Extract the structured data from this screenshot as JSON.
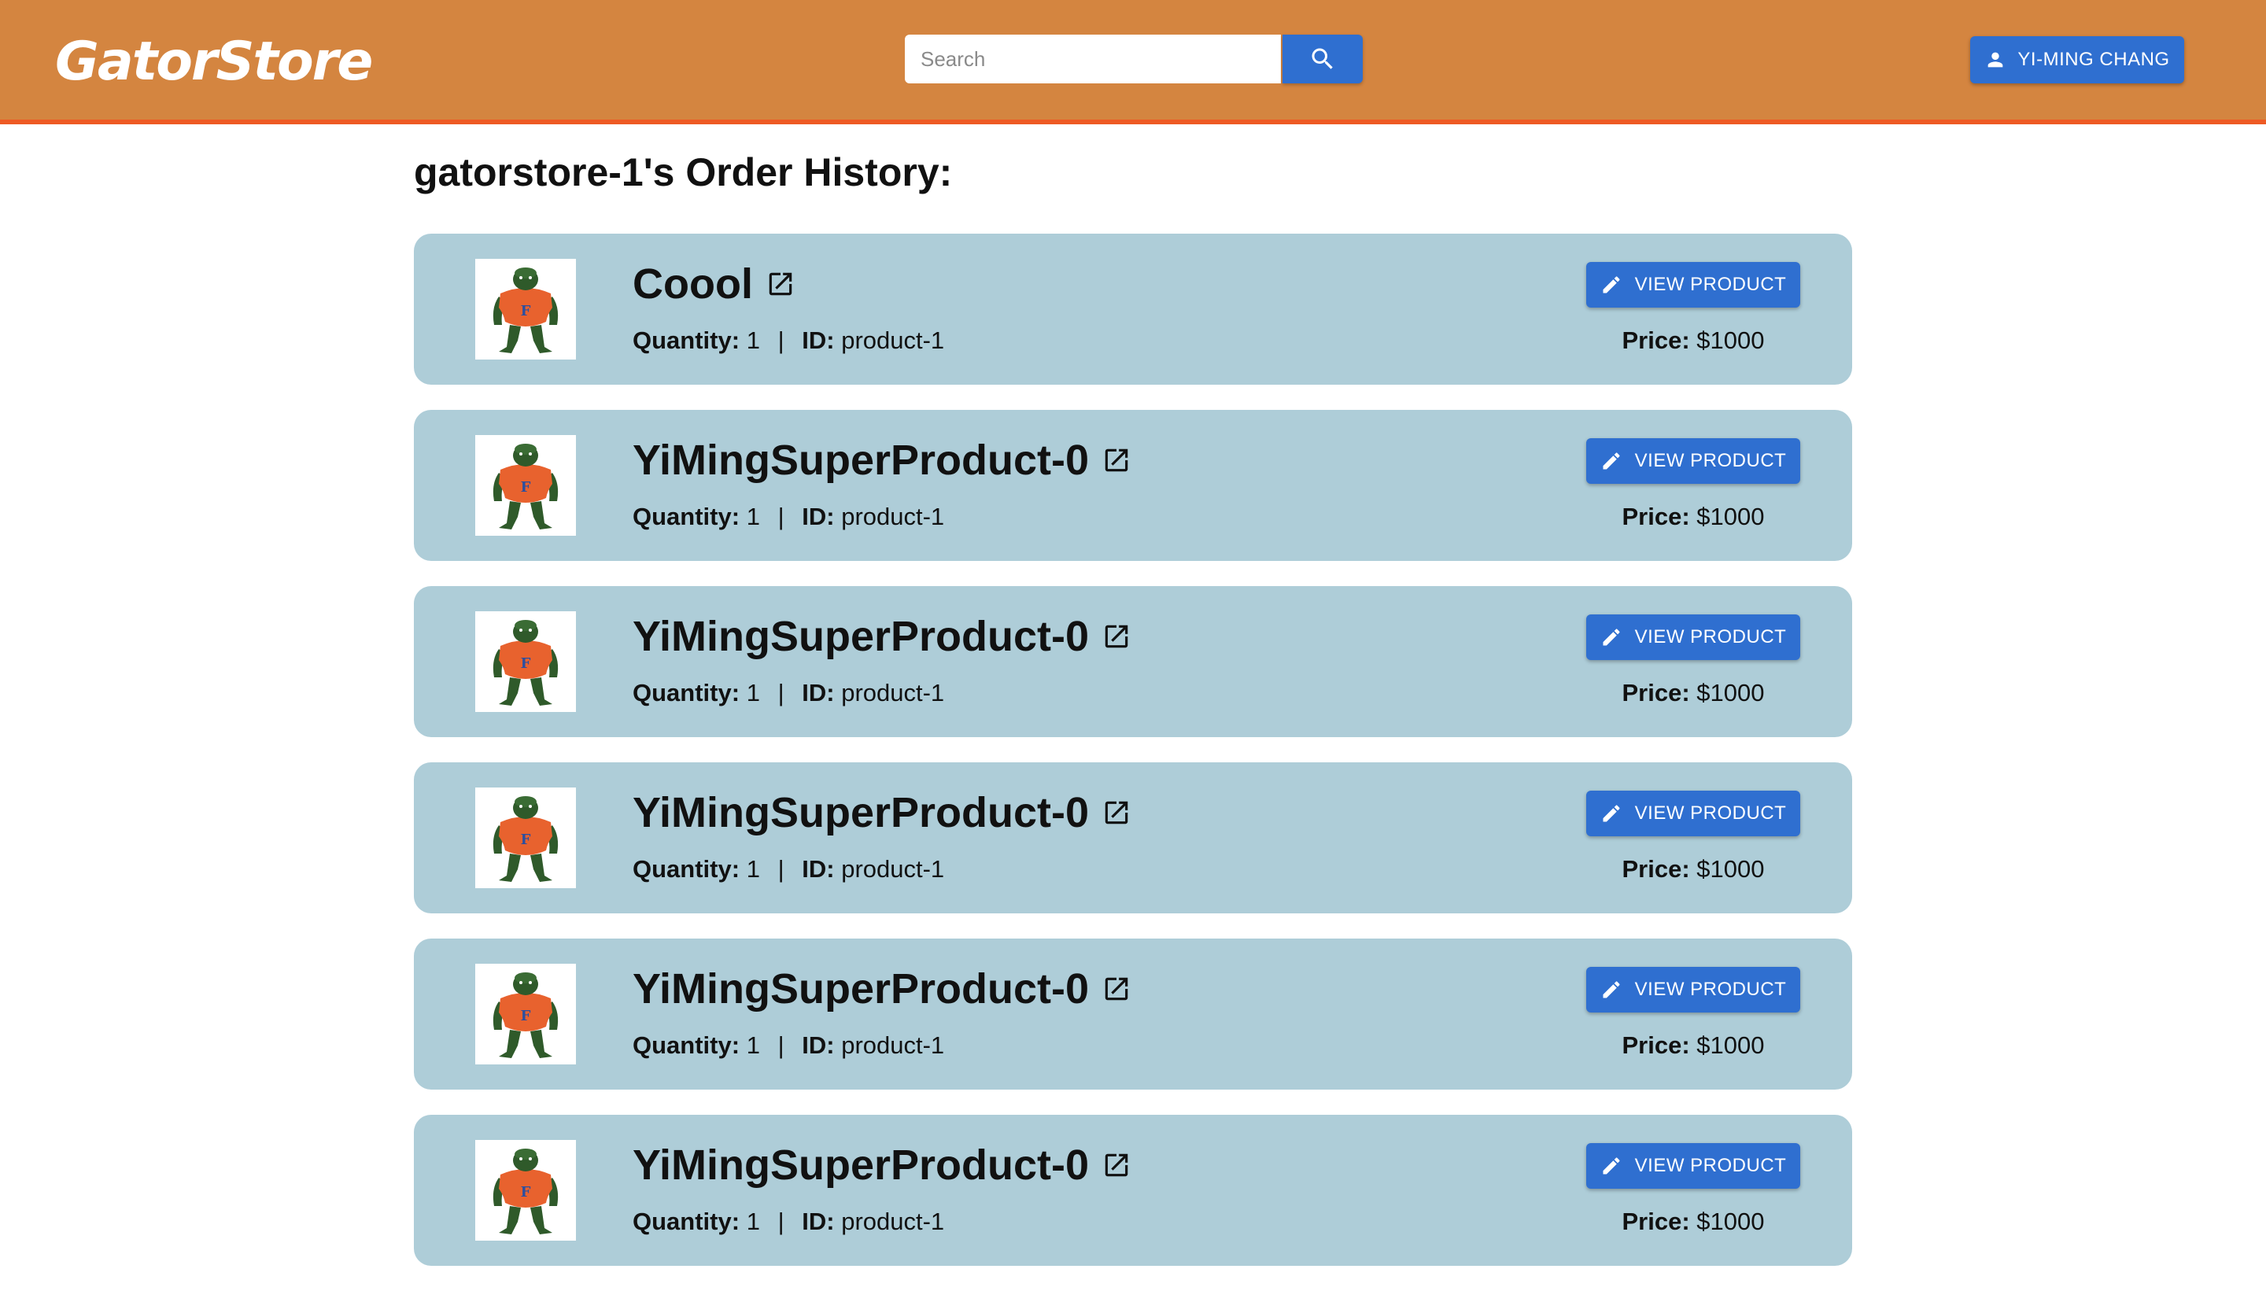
{
  "header": {
    "logo": "GatorStore",
    "search_placeholder": "Search",
    "search_value": "",
    "user_label": "YI-MING CHANG",
    "accent_color": "#d48540",
    "border_color": "#ee5a24",
    "button_color": "#2f6fd0"
  },
  "page": {
    "title": "gatorstore-1's Order History:"
  },
  "labels": {
    "quantity": "Quantity:",
    "id": "ID:",
    "price": "Price:",
    "separator": "|",
    "view_button": "VIEW PRODUCT"
  },
  "orders": [
    {
      "name": "Coool",
      "quantity": "1",
      "id": "product-1",
      "price": "$1000"
    },
    {
      "name": "YiMingSuperProduct-0",
      "quantity": "1",
      "id": "product-1",
      "price": "$1000"
    },
    {
      "name": "YiMingSuperProduct-0",
      "quantity": "1",
      "id": "product-1",
      "price": "$1000"
    },
    {
      "name": "YiMingSuperProduct-0",
      "quantity": "1",
      "id": "product-1",
      "price": "$1000"
    },
    {
      "name": "YiMingSuperProduct-0",
      "quantity": "1",
      "id": "product-1",
      "price": "$1000"
    },
    {
      "name": "YiMingSuperProduct-0",
      "quantity": "1",
      "id": "product-1",
      "price": "$1000"
    }
  ],
  "icons": {
    "search": "search-icon",
    "user": "person-icon",
    "external": "open-in-new-icon",
    "edit": "pencil-icon",
    "thumbnail": "gator-mascot-image"
  }
}
